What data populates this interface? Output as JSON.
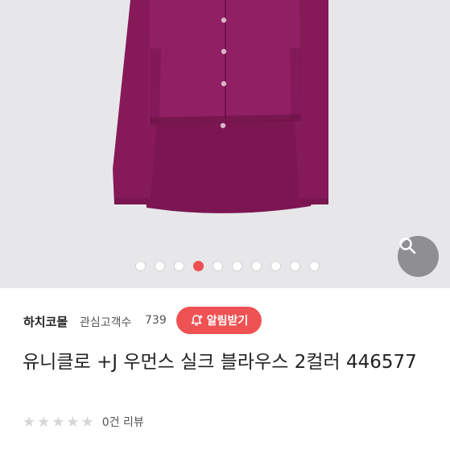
{
  "gallery": {
    "image": "purple-blouse-product-photo",
    "dot_count": 10,
    "active_dot_index": 3,
    "colors": {
      "background": "#e7e7e9",
      "blouse": "#8a1a5c",
      "active_dot": "#ee4f52"
    }
  },
  "zoom_button": {
    "icon": "search-icon"
  },
  "seller": {
    "name": "하치코몰",
    "follower_label": "관심고객수",
    "follower_count": "739",
    "alarm_button": {
      "label": "알림받기",
      "icon": "bell-plus-icon",
      "color": "#ef5253"
    }
  },
  "product": {
    "title": "유니클로 +J 우먼스 실크 블라우스 2컬러 446577"
  },
  "reviews": {
    "rating": 0,
    "max_rating": 5,
    "summary": "0건 리뷰"
  }
}
